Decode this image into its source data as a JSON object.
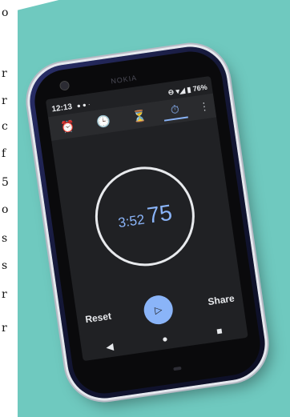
{
  "left_text_fragments": [
    "o",
    "r",
    "r",
    "c",
    "f",
    "5",
    "o",
    "s",
    "s",
    "r",
    "r"
  ],
  "phone": {
    "brand": "NOKIA",
    "status_bar": {
      "time": "12:13",
      "notification_dots": "● ● ·",
      "right_text": "⊖ ▾◢ ▮ 76%"
    },
    "tabs": [
      {
        "icon": "alarm-icon",
        "glyph": "⏰"
      },
      {
        "icon": "clock-icon",
        "glyph": "🕒"
      },
      {
        "icon": "timer-icon",
        "glyph": "⏳"
      },
      {
        "icon": "stopwatch-icon",
        "glyph": "⏱",
        "active": true
      }
    ],
    "menu_glyph": "⋮",
    "stopwatch": {
      "minutes_seconds": "3:52",
      "hundredths": "75"
    },
    "controls": {
      "reset": "Reset",
      "play_glyph": "▷",
      "share": "Share"
    },
    "nav": {
      "back": "◀",
      "home": "●",
      "recents": "■"
    }
  },
  "colors": {
    "mat": "#6fc9bf",
    "screen": "#202124",
    "accent": "#8ab4f8"
  }
}
